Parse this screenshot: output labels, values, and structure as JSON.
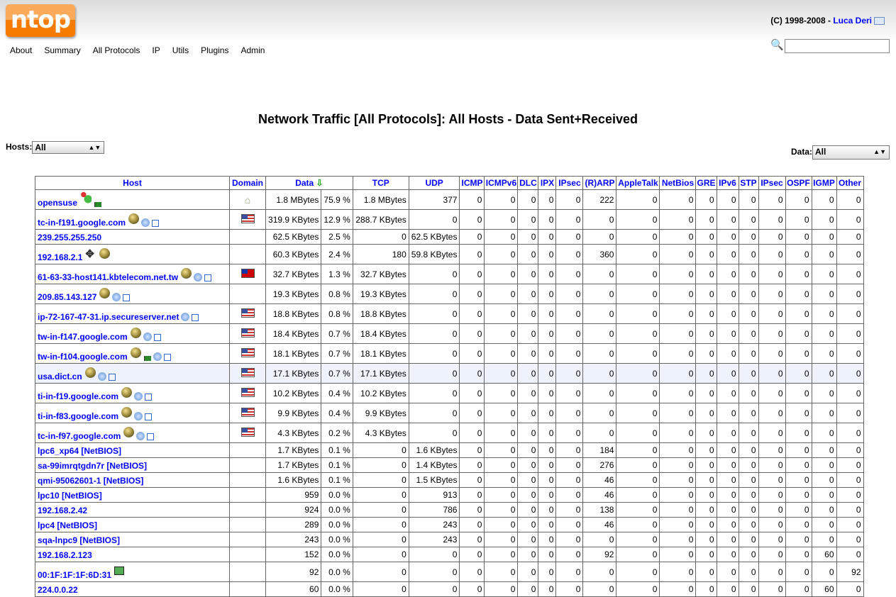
{
  "brand": {
    "logo": "ntop",
    "copyright": "(C) 1998-2008 - ",
    "author": "Luca Deri"
  },
  "nav": [
    "About",
    "Summary",
    "All Protocols",
    "IP",
    "Utils",
    "Plugins",
    "Admin"
  ],
  "search": {
    "placeholder": "",
    "value": ""
  },
  "title": "Network Traffic [All Protocols]: All Hosts - Data Sent+Received",
  "filters": {
    "hosts_label": "Hosts",
    "hosts_value": "All",
    "data_label": "Data",
    "data_value": "All"
  },
  "columns": [
    "Host",
    "Domain",
    "Data",
    "TCP",
    "UDP",
    "ICMP",
    "ICMPv6",
    "DLC",
    "IPX",
    "IPsec",
    "(R)ARP",
    "AppleTalk",
    "NetBios",
    "GRE",
    "IPv6",
    "STP",
    "IPsec",
    "OSPF",
    "IGMP",
    "Other"
  ],
  "sort_icon": "arrow-down-icon",
  "rows": [
    {
      "host": "opensuse",
      "icons": [
        "users-icon",
        "green-flag-icon"
      ],
      "domain": "home-icon",
      "data": "1.8 MBytes",
      "pct": "75.9 %",
      "p": [
        "1.8 MBytes",
        "377",
        "0",
        "0",
        "0",
        "0",
        "0",
        "222",
        "0",
        "0",
        "0",
        "0",
        "0",
        "0",
        "0",
        "0",
        "0"
      ]
    },
    {
      "host": "tc-in-f191.google.com",
      "icons": [
        "globe-icon",
        "satellite-icon",
        "external-link-icon"
      ],
      "domain": "us-flag-icon",
      "data": "319.9 KBytes",
      "pct": "12.9 %",
      "p": [
        "288.7 KBytes",
        "0",
        "0",
        "0",
        "0",
        "0",
        "0",
        "0",
        "0",
        "0",
        "0",
        "0",
        "0",
        "0",
        "0",
        "0",
        "0"
      ]
    },
    {
      "host": "239.255.255.250",
      "icons": [],
      "domain": "",
      "data": "62.5 KBytes",
      "pct": "2.5 %",
      "p": [
        "0",
        "62.5 KBytes",
        "0",
        "0",
        "0",
        "0",
        "0",
        "0",
        "0",
        "0",
        "0",
        "0",
        "0",
        "0",
        "0",
        "0",
        "0"
      ]
    },
    {
      "host": "192.168.2.1",
      "icons": [
        "router-icon",
        "globe-icon"
      ],
      "domain": "",
      "data": "60.3 KBytes",
      "pct": "2.4 %",
      "p": [
        "180",
        "59.8 KBytes",
        "0",
        "0",
        "0",
        "0",
        "0",
        "360",
        "0",
        "0",
        "0",
        "0",
        "0",
        "0",
        "0",
        "0",
        "0"
      ]
    },
    {
      "host": "61-63-33-host141.kbtelecom.net.tw",
      "icons": [
        "globe-icon",
        "satellite-icon",
        "external-link-icon"
      ],
      "domain": "tw-flag-icon",
      "data": "32.7 KBytes",
      "pct": "1.3 %",
      "p": [
        "32.7 KBytes",
        "0",
        "0",
        "0",
        "0",
        "0",
        "0",
        "0",
        "0",
        "0",
        "0",
        "0",
        "0",
        "0",
        "0",
        "0",
        "0"
      ]
    },
    {
      "host": "209.85.143.127",
      "icons": [
        "globe-icon",
        "satellite-icon",
        "external-link-icon"
      ],
      "domain": "",
      "data": "19.3 KBytes",
      "pct": "0.8 %",
      "p": [
        "19.3 KBytes",
        "0",
        "0",
        "0",
        "0",
        "0",
        "0",
        "0",
        "0",
        "0",
        "0",
        "0",
        "0",
        "0",
        "0",
        "0",
        "0"
      ]
    },
    {
      "host": "ip-72-167-47-31.ip.secureserver.net",
      "icons": [
        "satellite-icon",
        "external-link-icon"
      ],
      "domain": "us-flag-icon",
      "data": "18.8 KBytes",
      "pct": "0.8 %",
      "p": [
        "18.8 KBytes",
        "0",
        "0",
        "0",
        "0",
        "0",
        "0",
        "0",
        "0",
        "0",
        "0",
        "0",
        "0",
        "0",
        "0",
        "0",
        "0"
      ]
    },
    {
      "host": "tw-in-f147.google.com",
      "icons": [
        "globe-icon",
        "satellite-icon",
        "external-link-icon"
      ],
      "domain": "us-flag-icon",
      "data": "18.4 KBytes",
      "pct": "0.7 %",
      "p": [
        "18.4 KBytes",
        "0",
        "0",
        "0",
        "0",
        "0",
        "0",
        "0",
        "0",
        "0",
        "0",
        "0",
        "0",
        "0",
        "0",
        "0",
        "0"
      ]
    },
    {
      "host": "tw-in-f104.google.com",
      "icons": [
        "globe-icon",
        "green-flag-icon",
        "satellite-icon",
        "external-link-icon"
      ],
      "domain": "us-flag-icon",
      "data": "18.1 KBytes",
      "pct": "0.7 %",
      "p": [
        "18.1 KBytes",
        "0",
        "0",
        "0",
        "0",
        "0",
        "0",
        "0",
        "0",
        "0",
        "0",
        "0",
        "0",
        "0",
        "0",
        "0",
        "0"
      ]
    },
    {
      "host": "usa.dict.cn",
      "icons": [
        "globe-icon",
        "satellite-icon",
        "external-link-icon"
      ],
      "domain": "us-flag-icon",
      "data": "17.1 KBytes",
      "pct": "0.7 %",
      "hl": true,
      "p": [
        "17.1 KBytes",
        "0",
        "0",
        "0",
        "0",
        "0",
        "0",
        "0",
        "0",
        "0",
        "0",
        "0",
        "0",
        "0",
        "0",
        "0",
        "0"
      ]
    },
    {
      "host": "ti-in-f19.google.com",
      "icons": [
        "globe-icon",
        "satellite-icon",
        "external-link-icon"
      ],
      "domain": "us-flag-icon",
      "data": "10.2 KBytes",
      "pct": "0.4 %",
      "p": [
        "10.2 KBytes",
        "0",
        "0",
        "0",
        "0",
        "0",
        "0",
        "0",
        "0",
        "0",
        "0",
        "0",
        "0",
        "0",
        "0",
        "0",
        "0"
      ]
    },
    {
      "host": "ti-in-f83.google.com",
      "icons": [
        "globe-icon",
        "satellite-icon",
        "external-link-icon"
      ],
      "domain": "us-flag-icon",
      "data": "9.9 KBytes",
      "pct": "0.4 %",
      "p": [
        "9.9 KBytes",
        "0",
        "0",
        "0",
        "0",
        "0",
        "0",
        "0",
        "0",
        "0",
        "0",
        "0",
        "0",
        "0",
        "0",
        "0",
        "0"
      ]
    },
    {
      "host": "tc-in-f97.google.com",
      "icons": [
        "globe-icon",
        "satellite-icon",
        "external-link-icon"
      ],
      "domain": "us-flag-icon",
      "data": "4.3 KBytes",
      "pct": "0.2 %",
      "p": [
        "4.3 KBytes",
        "0",
        "0",
        "0",
        "0",
        "0",
        "0",
        "0",
        "0",
        "0",
        "0",
        "0",
        "0",
        "0",
        "0",
        "0",
        "0"
      ]
    },
    {
      "host": "lpc6_xp64 [NetBIOS]",
      "icons": [],
      "domain": "",
      "data": "1.7 KBytes",
      "pct": "0.1 %",
      "p": [
        "0",
        "1.6 KBytes",
        "0",
        "0",
        "0",
        "0",
        "0",
        "184",
        "0",
        "0",
        "0",
        "0",
        "0",
        "0",
        "0",
        "0",
        "0"
      ]
    },
    {
      "host": "sa-99imrqtgdn7r [NetBIOS]",
      "icons": [],
      "domain": "",
      "data": "1.7 KBytes",
      "pct": "0.1 %",
      "p": [
        "0",
        "1.4 KBytes",
        "0",
        "0",
        "0",
        "0",
        "0",
        "276",
        "0",
        "0",
        "0",
        "0",
        "0",
        "0",
        "0",
        "0",
        "0"
      ]
    },
    {
      "host": "qmi-95062601-1 [NetBIOS]",
      "icons": [],
      "domain": "",
      "data": "1.6 KBytes",
      "pct": "0.1 %",
      "p": [
        "0",
        "1.5 KBytes",
        "0",
        "0",
        "0",
        "0",
        "0",
        "46",
        "0",
        "0",
        "0",
        "0",
        "0",
        "0",
        "0",
        "0",
        "0"
      ]
    },
    {
      "host": "lpc10 [NetBIOS]",
      "icons": [],
      "domain": "",
      "data": "959",
      "pct": "0.0 %",
      "p": [
        "0",
        "913",
        "0",
        "0",
        "0",
        "0",
        "0",
        "46",
        "0",
        "0",
        "0",
        "0",
        "0",
        "0",
        "0",
        "0",
        "0"
      ]
    },
    {
      "host": "192.168.2.42",
      "icons": [],
      "domain": "",
      "data": "924",
      "pct": "0.0 %",
      "p": [
        "0",
        "786",
        "0",
        "0",
        "0",
        "0",
        "0",
        "138",
        "0",
        "0",
        "0",
        "0",
        "0",
        "0",
        "0",
        "0",
        "0"
      ]
    },
    {
      "host": "lpc4 [NetBIOS]",
      "icons": [],
      "domain": "",
      "data": "289",
      "pct": "0.0 %",
      "p": [
        "0",
        "243",
        "0",
        "0",
        "0",
        "0",
        "0",
        "46",
        "0",
        "0",
        "0",
        "0",
        "0",
        "0",
        "0",
        "0",
        "0"
      ]
    },
    {
      "host": "sqa-lnpc9 [NetBIOS]",
      "icons": [],
      "domain": "",
      "data": "243",
      "pct": "0.0 %",
      "p": [
        "0",
        "243",
        "0",
        "0",
        "0",
        "0",
        "0",
        "0",
        "0",
        "0",
        "0",
        "0",
        "0",
        "0",
        "0",
        "0",
        "0"
      ]
    },
    {
      "host": "192.168.2.123",
      "icons": [],
      "domain": "",
      "data": "152",
      "pct": "0.0 %",
      "p": [
        "0",
        "0",
        "0",
        "0",
        "0",
        "0",
        "0",
        "92",
        "0",
        "0",
        "0",
        "0",
        "0",
        "0",
        "0",
        "60",
        "0"
      ]
    },
    {
      "host": "00:1F:1F:1F:6D:31",
      "icons": [
        "network-card-icon"
      ],
      "domain": "",
      "data": "92",
      "pct": "0.0 %",
      "p": [
        "0",
        "0",
        "0",
        "0",
        "0",
        "0",
        "0",
        "0",
        "0",
        "0",
        "0",
        "0",
        "0",
        "0",
        "0",
        "0",
        "92"
      ]
    },
    {
      "host": "224.0.0.22",
      "icons": [],
      "domain": "",
      "data": "60",
      "pct": "0.0 %",
      "p": [
        "0",
        "0",
        "0",
        "0",
        "0",
        "0",
        "0",
        "0",
        "0",
        "0",
        "0",
        "0",
        "0",
        "0",
        "0",
        "60",
        "0"
      ]
    }
  ]
}
